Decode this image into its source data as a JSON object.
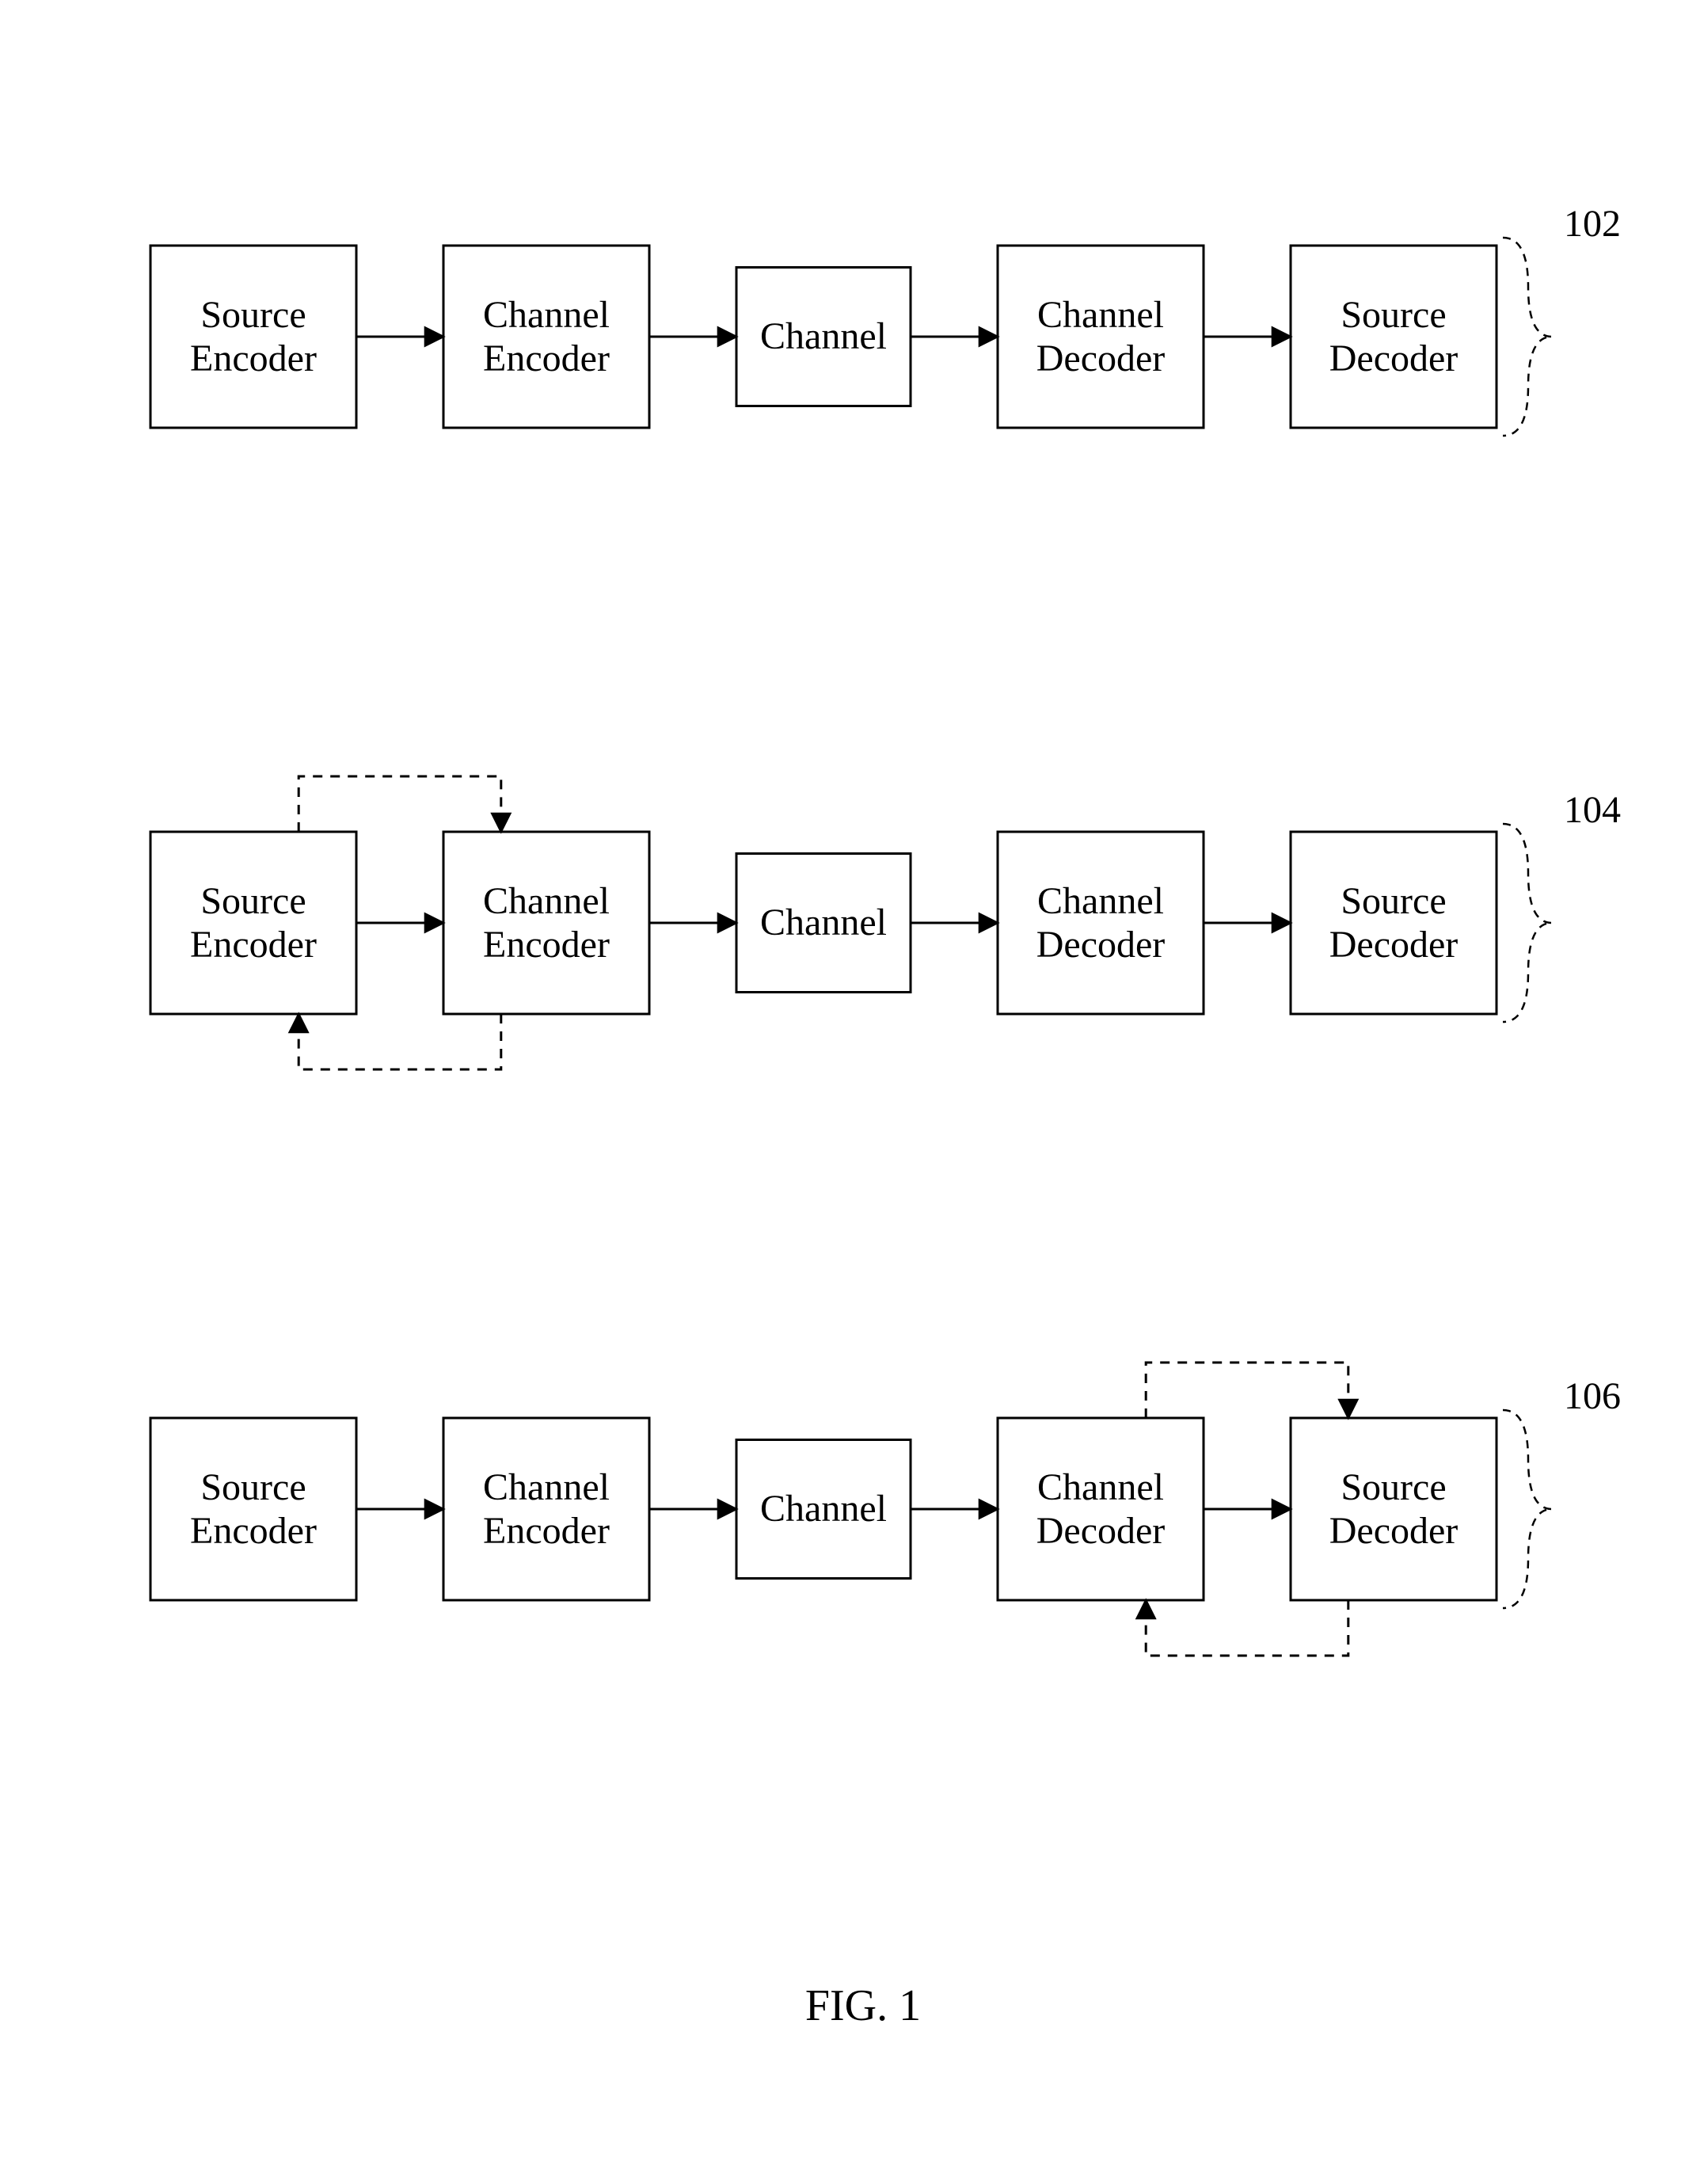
{
  "figure_label": "FIG. 1",
  "rows": [
    {
      "ref": "102",
      "blocks": [
        "Source\nEncoder",
        "Channel\nEncoder",
        "Channel",
        "Channel\nDecoder",
        "Source\nDecoder"
      ],
      "feedback": null
    },
    {
      "ref": "104",
      "blocks": [
        "Source\nEncoder",
        "Channel\nEncoder",
        "Channel",
        "Channel\nDecoder",
        "Source\nDecoder"
      ],
      "feedback": "left"
    },
    {
      "ref": "106",
      "blocks": [
        "Source\nEncoder",
        "Channel\nEncoder",
        "Channel",
        "Channel\nDecoder",
        "Source\nDecoder"
      ],
      "feedback": "right"
    }
  ]
}
